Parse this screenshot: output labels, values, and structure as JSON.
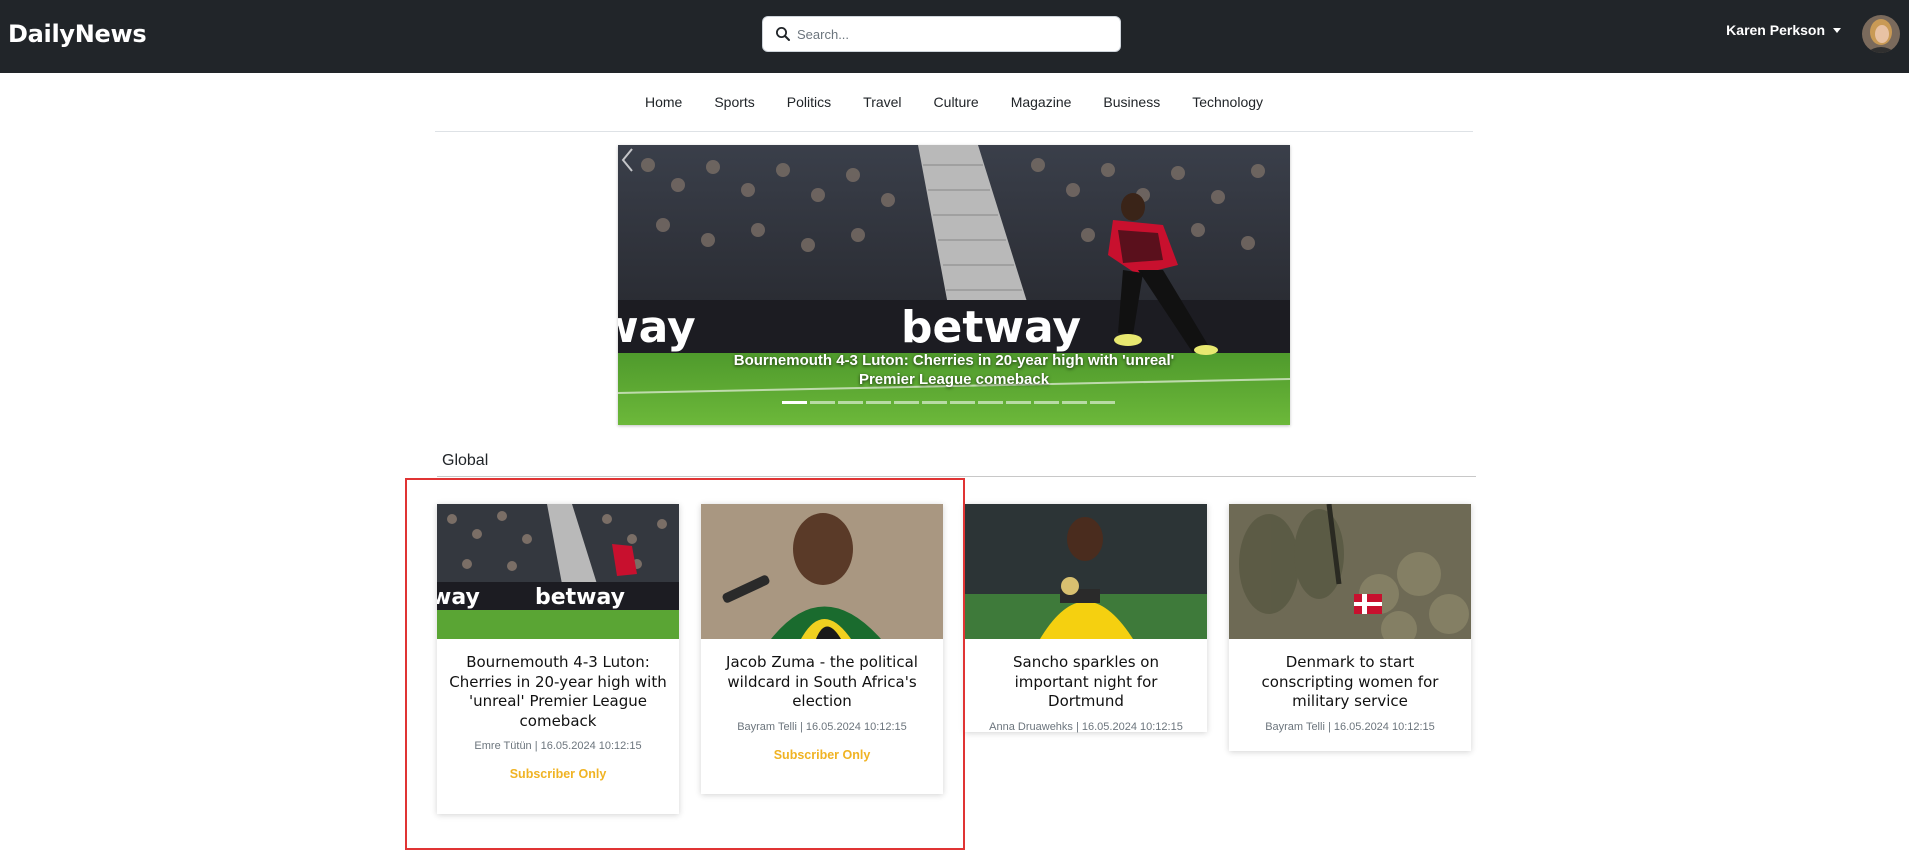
{
  "header": {
    "brand": "DailyNews",
    "search_placeholder": "Search...",
    "user_name": "Karen Perkson",
    "icons": {
      "search": "search-icon",
      "caret": "caret-down-icon",
      "avatar": "avatar"
    }
  },
  "nav": {
    "items": [
      "Home",
      "Sports",
      "Politics",
      "Travel",
      "Culture",
      "Magazine",
      "Business",
      "Technology"
    ]
  },
  "hero": {
    "caption": "Bournemouth 4-3 Luton: Cherries in 20-year high with 'unreal' Premier League comeback",
    "banner_text": "betway",
    "slide_count": 12,
    "active_slide": 1
  },
  "section": {
    "title": "Global"
  },
  "articles": [
    {
      "title": "Bournemouth 4-3 Luton: Cherries in 20-year high with 'unreal' Premier League comeback",
      "meta": "Emre Tütün | 16.05.2024 10:12:15",
      "badge": "Subscriber Only"
    },
    {
      "title": "Jacob Zuma - the political wildcard in South Africa's election",
      "meta": "Bayram Telli | 16.05.2024 10:12:15",
      "badge": "Subscriber Only"
    },
    {
      "title": "Sancho sparkles on important night for Dortmund",
      "meta": "Anna Druawehks | 16.05.2024 10:12:15",
      "badge": ""
    },
    {
      "title": "Denmark to start conscripting women for military service",
      "meta": "Bayram Telli | 16.05.2024 10:12:15",
      "badge": ""
    }
  ],
  "colors": {
    "header_bg": "#212529",
    "badge": "#f0b323",
    "highlight": "#e03434"
  }
}
